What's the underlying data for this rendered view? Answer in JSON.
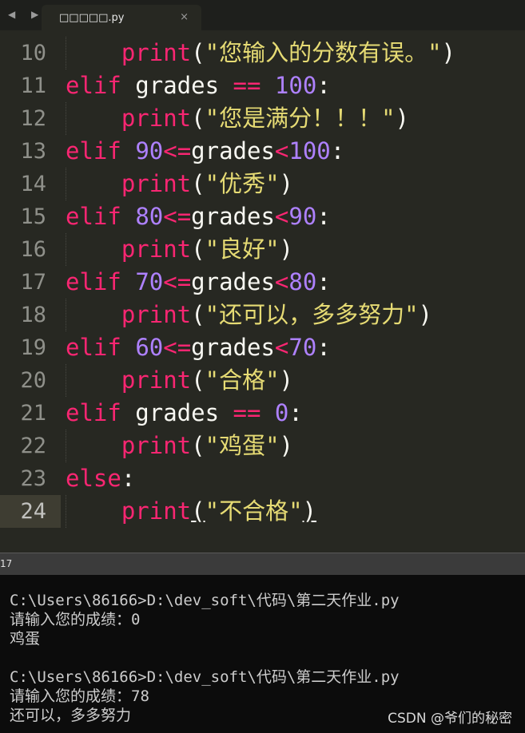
{
  "tab": {
    "nav_arrows": "◀ ▶",
    "title": "□□□□□.py",
    "close_glyph": "×"
  },
  "editor": {
    "lines": [
      {
        "number": "10",
        "indent": "    ",
        "tokens": [
          [
            "fn",
            "print"
          ],
          [
            "pl",
            "("
          ],
          [
            "str",
            "\"您输入的分数有误。\""
          ],
          [
            "pl",
            ")"
          ]
        ]
      },
      {
        "number": "11",
        "indent": "",
        "tokens": [
          [
            "kw",
            "elif"
          ],
          [
            "pl",
            " grades "
          ],
          [
            "op",
            "=="
          ],
          [
            "pl",
            " "
          ],
          [
            "num",
            "100"
          ],
          [
            "pl",
            ":"
          ]
        ]
      },
      {
        "number": "12",
        "indent": "    ",
        "tokens": [
          [
            "fn",
            "print"
          ],
          [
            "pl",
            "("
          ],
          [
            "str",
            "\"您是满分！！！\""
          ],
          [
            "pl",
            ")"
          ]
        ]
      },
      {
        "number": "13",
        "indent": "",
        "tokens": [
          [
            "kw",
            "elif"
          ],
          [
            "pl",
            " "
          ],
          [
            "num",
            "90"
          ],
          [
            "op",
            "<="
          ],
          [
            "pl",
            "grades"
          ],
          [
            "op",
            "<"
          ],
          [
            "num",
            "100"
          ],
          [
            "pl",
            ":"
          ]
        ]
      },
      {
        "number": "14",
        "indent": "    ",
        "tokens": [
          [
            "fn",
            "print"
          ],
          [
            "pl",
            "("
          ],
          [
            "str",
            "\"优秀\""
          ],
          [
            "pl",
            ")"
          ]
        ]
      },
      {
        "number": "15",
        "indent": "",
        "tokens": [
          [
            "kw",
            "elif"
          ],
          [
            "pl",
            " "
          ],
          [
            "num",
            "80"
          ],
          [
            "op",
            "<="
          ],
          [
            "pl",
            "grades"
          ],
          [
            "op",
            "<"
          ],
          [
            "num",
            "90"
          ],
          [
            "pl",
            ":"
          ]
        ]
      },
      {
        "number": "16",
        "indent": "    ",
        "tokens": [
          [
            "fn",
            "print"
          ],
          [
            "pl",
            "("
          ],
          [
            "str",
            "\"良好\""
          ],
          [
            "pl",
            ")"
          ]
        ]
      },
      {
        "number": "17",
        "indent": "",
        "tokens": [
          [
            "kw",
            "elif"
          ],
          [
            "pl",
            " "
          ],
          [
            "num",
            "70"
          ],
          [
            "op",
            "<="
          ],
          [
            "pl",
            "grades"
          ],
          [
            "op",
            "<"
          ],
          [
            "num",
            "80"
          ],
          [
            "pl",
            ":"
          ]
        ]
      },
      {
        "number": "18",
        "indent": "    ",
        "tokens": [
          [
            "fn",
            "print"
          ],
          [
            "pl",
            "("
          ],
          [
            "str",
            "\"还可以，多多努力\""
          ],
          [
            "pl",
            ")"
          ]
        ]
      },
      {
        "number": "19",
        "indent": "",
        "tokens": [
          [
            "kw",
            "elif"
          ],
          [
            "pl",
            " "
          ],
          [
            "num",
            "60"
          ],
          [
            "op",
            "<="
          ],
          [
            "pl",
            "grades"
          ],
          [
            "op",
            "<"
          ],
          [
            "num",
            "70"
          ],
          [
            "pl",
            ":"
          ]
        ]
      },
      {
        "number": "20",
        "indent": "    ",
        "tokens": [
          [
            "fn",
            "print"
          ],
          [
            "pl",
            "("
          ],
          [
            "str",
            "\"合格\""
          ],
          [
            "pl",
            ")"
          ]
        ]
      },
      {
        "number": "21",
        "indent": "",
        "tokens": [
          [
            "kw",
            "elif"
          ],
          [
            "pl",
            " grades "
          ],
          [
            "op",
            "=="
          ],
          [
            "pl",
            " "
          ],
          [
            "num",
            "0"
          ],
          [
            "pl",
            ":"
          ]
        ]
      },
      {
        "number": "22",
        "indent": "    ",
        "tokens": [
          [
            "fn",
            "print"
          ],
          [
            "pl",
            "("
          ],
          [
            "str",
            "\"鸡蛋\""
          ],
          [
            "pl",
            ")"
          ]
        ]
      },
      {
        "number": "23",
        "indent": "",
        "tokens": [
          [
            "kw",
            "else"
          ],
          [
            "pl",
            ":"
          ]
        ]
      },
      {
        "number": "24",
        "indent": "    ",
        "current": true,
        "tokens": [
          [
            "fn",
            "print"
          ],
          [
            "pl under",
            "("
          ],
          [
            "str",
            "\"不合格\""
          ],
          [
            "pl under",
            ")"
          ]
        ]
      }
    ]
  },
  "status": {
    "text": "17"
  },
  "console": {
    "lines": [
      "C:\\Users\\86166>D:\\dev_soft\\代码\\第二天作业.py",
      "请输入您的成绩：0",
      "鸡蛋",
      "",
      "C:\\Users\\86166>D:\\dev_soft\\代码\\第二天作业.py",
      "请输入您的成绩：78",
      "还可以，多多努力"
    ],
    "watermark": "CSDN @爷们的秘密"
  },
  "colors": {
    "editor_bg": "#272822",
    "keyword": "#f92672",
    "number": "#ae81ff",
    "string": "#e6db74",
    "plain": "#f8f8f2",
    "console_bg": "#0c0c0c"
  }
}
